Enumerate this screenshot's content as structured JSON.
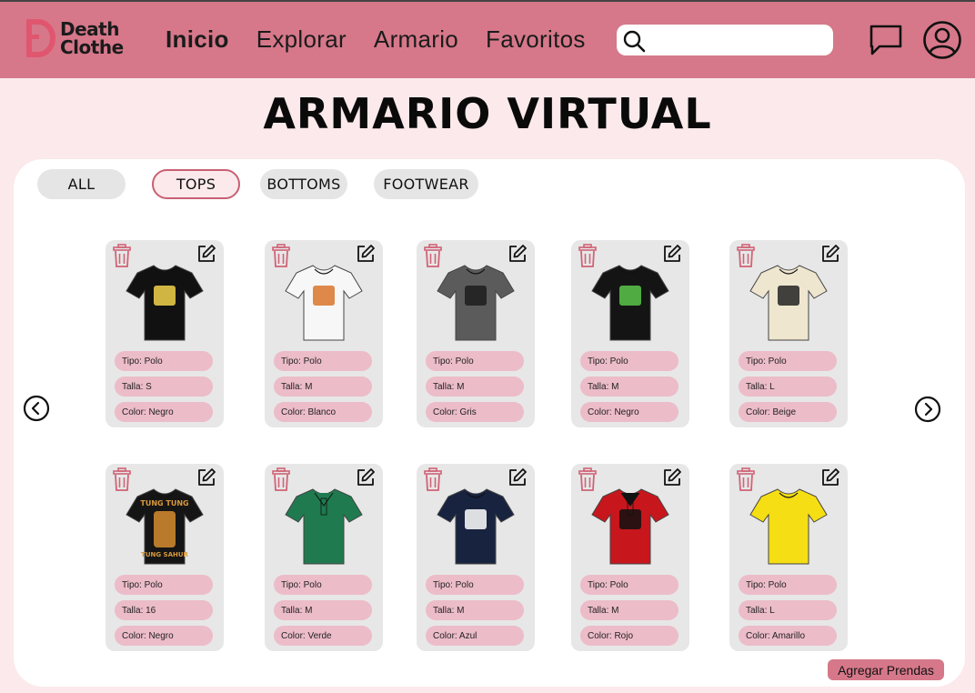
{
  "brand": {
    "line1": "Death",
    "line2": "Clothe",
    "accent": "#e0566f"
  },
  "nav": [
    {
      "label": "Inicio",
      "active": true
    },
    {
      "label": "Explorar",
      "active": false
    },
    {
      "label": "Armario",
      "active": false
    },
    {
      "label": "Favoritos",
      "active": false
    }
  ],
  "search": {
    "placeholder": ""
  },
  "title": "ARMARIO VIRTUAL",
  "filters": [
    {
      "label": "ALL",
      "selected": false
    },
    {
      "label": "TOPS",
      "selected": true
    },
    {
      "label": "BOTTOMS",
      "selected": false
    },
    {
      "label": "FOOTWEAR",
      "selected": false
    }
  ],
  "cards": [
    {
      "tipo": "Tipo: Polo",
      "talla": "Talla: S",
      "color": "Color: Negro",
      "swatch": "#111111",
      "collar": "tee",
      "print": "#f2d24b"
    },
    {
      "tipo": "Tipo: Polo",
      "talla": "Talla: M",
      "color": "Color: Blanco",
      "swatch": "#f7f7f7",
      "collar": "tee",
      "print": "#d9742b"
    },
    {
      "tipo": "Tipo: Polo",
      "talla": "Talla: M",
      "color": "Color: Gris",
      "swatch": "#5b5b5b",
      "collar": "tee",
      "print": "#1d1d1d"
    },
    {
      "tipo": "Tipo: Polo",
      "talla": "Talla: M",
      "color": "Color: Negro",
      "swatch": "#141414",
      "collar": "tee",
      "print": "#59c64a"
    },
    {
      "tipo": "Tipo: Polo",
      "talla": "Talla: L",
      "color": "Color: Beige",
      "swatch": "#efe6cf",
      "collar": "tee",
      "print": "#222222"
    },
    {
      "tipo": "Tipo: Polo",
      "talla": "Talla: 16",
      "color": "Color: Negro",
      "swatch": "#151515",
      "collar": "tee",
      "print": "#b97a2b",
      "print_text": [
        "TUNG TUNG",
        "TUNG SAHUR"
      ]
    },
    {
      "tipo": "Tipo: Polo",
      "talla": "Talla: M",
      "color": "Color: Verde",
      "swatch": "#1f7a4f",
      "collar": "polo",
      "print": "#1f7a4f"
    },
    {
      "tipo": "Tipo: Polo",
      "talla": "Talla: M",
      "color": "Color: Azul",
      "swatch": "#18233f",
      "collar": "tee",
      "print": "#ffffff"
    },
    {
      "tipo": "Tipo: Polo",
      "talla": "Talla: M",
      "color": "Color: Rojo",
      "swatch": "#c8161d",
      "collar": "polo",
      "print": "#111111"
    },
    {
      "tipo": "Tipo: Polo",
      "talla": "Talla: L",
      "color": "Color: Amarillo",
      "swatch": "#f5de13",
      "collar": "tee",
      "print": "#f5de13"
    }
  ],
  "add_button": "Agregar Prendas",
  "colors": {
    "header": "#d6788a",
    "background": "#fbe9eb",
    "tag": "#ecbcc9",
    "trash": "#d06376"
  }
}
